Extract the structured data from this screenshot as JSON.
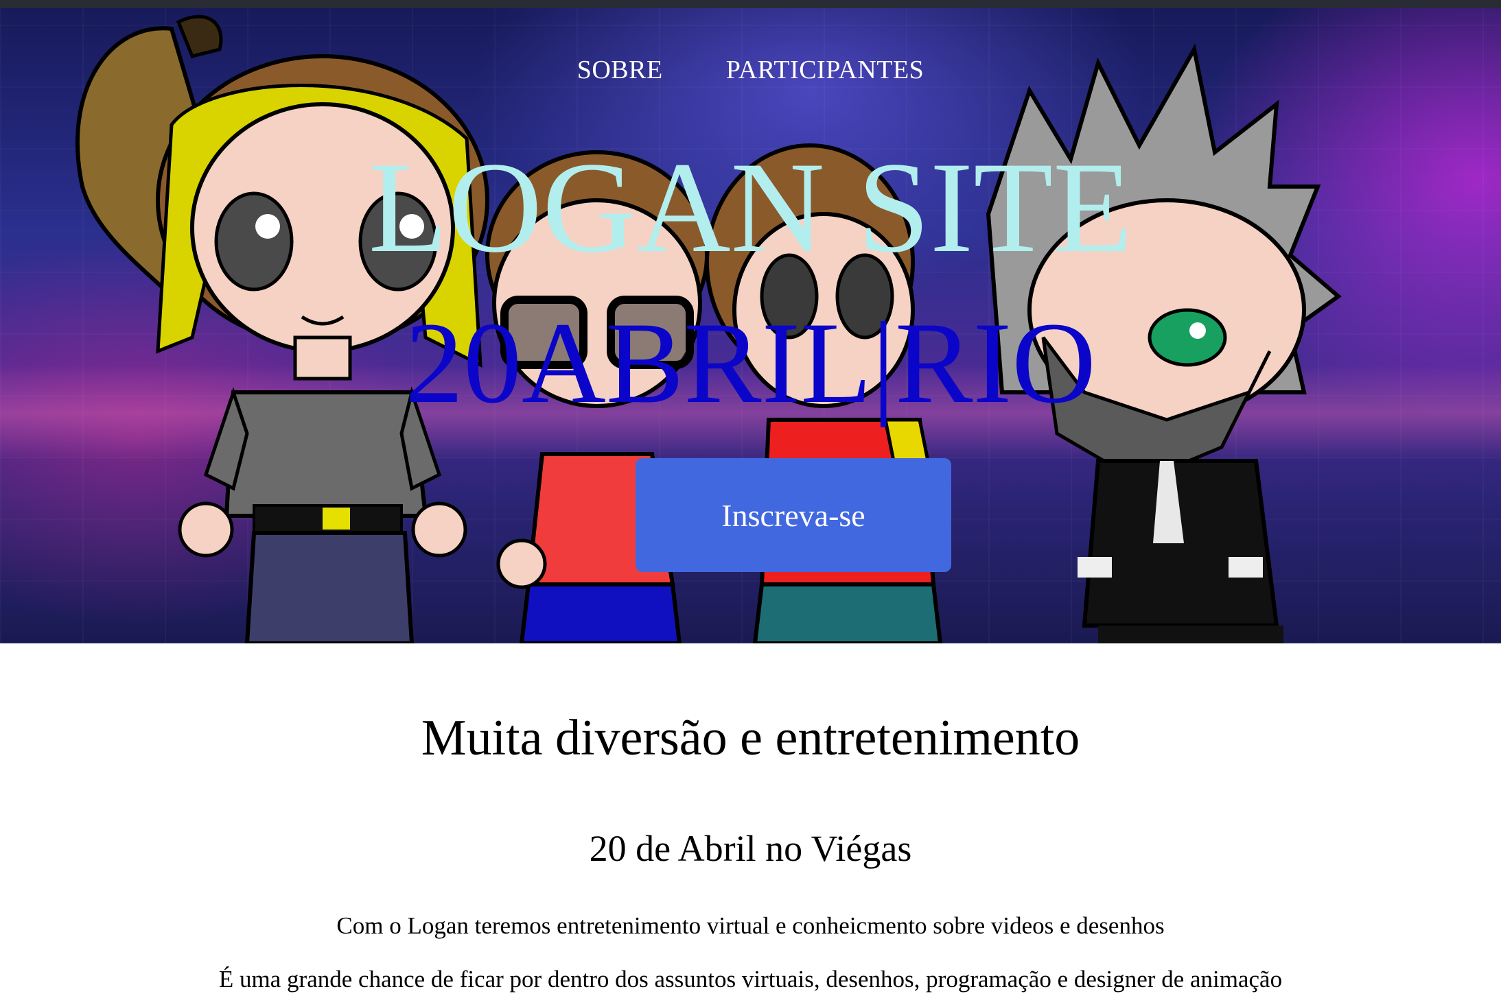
{
  "nav": {
    "items": [
      {
        "label": "SOBRE"
      },
      {
        "label": "PARTICIPANTES"
      }
    ]
  },
  "hero": {
    "title": "LOGAN SITE",
    "subtitle": "20ABRIL|RIO",
    "cta_label": "Inscreva-se",
    "colors": {
      "title": "#b3eeee",
      "subtitle": "#0a05c8",
      "cta_bg": "#4268e0"
    }
  },
  "content": {
    "heading": "Muita diversão e entretenimento",
    "subheading": "20 de Abril no Viégas",
    "paragraphs": [
      "Com o Logan teremos entretenimento virtual e conheicmento sobre videos e desenhos",
      "É uma grande chance de ficar por dentro dos assuntos virtuais, desenhos, programação e designer de animação"
    ]
  }
}
